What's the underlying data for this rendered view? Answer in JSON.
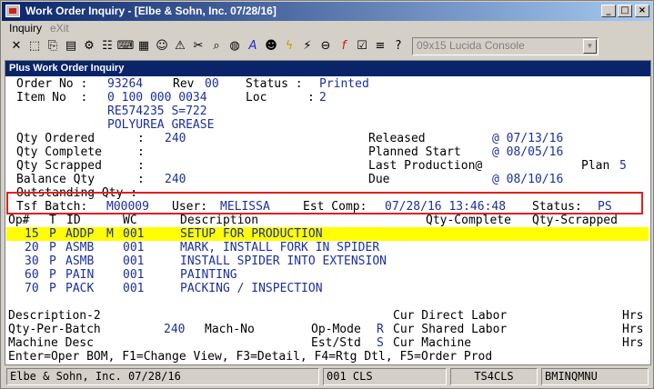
{
  "window": {
    "title": "Work Order Inquiry - [Elbe & Sohn, Inc. 07/28/16]"
  },
  "menu": {
    "items": [
      "Inquiry",
      "eXit"
    ]
  },
  "toolbar": {
    "font_combo": "09x15 Lucida Console"
  },
  "screen": {
    "title": "Plus Work Order Inquiry",
    "order_no_label": "Order No :",
    "order_no": "93264",
    "rev_label": "Rev",
    "rev": "00",
    "status_label": "Status :",
    "status": "Printed",
    "item_no_label": "Item No  :",
    "item_no": "0 100 000 0034",
    "loc_label": "Loc",
    "loc_colon": ":",
    "loc": "2",
    "item_line2": "RE574235 S=722",
    "item_line3": "POLYUREA GREASE",
    "qty_ordered_label": "Qty Ordered      :",
    "qty_ordered": "240",
    "qty_complete_label": "Qty Complete     :",
    "qty_scrapped_label": "Qty Scrapped     :",
    "balance_qty_label": "Balance Qty      :",
    "balance_qty": "240",
    "outstanding_label": "Outstanding Qty :",
    "released_label": "Released",
    "released": "@ 07/13/16",
    "planned_start_label": "Planned Start",
    "planned_start": "@ 08/05/16",
    "last_production_label": "Last Production@",
    "plan_label": "Plan",
    "plan": "5",
    "due_label": "Due",
    "due": "@ 08/10/16",
    "tsf_batch_label": "Tsf Batch:",
    "tsf_batch": "M00009",
    "user_label": "User:",
    "user": "MELISSA",
    "est_comp_label": "Est Comp:",
    "est_comp": "07/28/16 13:46:48",
    "tsf_status_label": "Status:",
    "tsf_status": "PS",
    "columns": {
      "op": "Op#",
      "t": "T",
      "id": "ID",
      "wc": "WC",
      "desc": "Description",
      "qty_complete": "Qty-Complete",
      "qty_scrapped": "Qty-Scrapped"
    },
    "operations": [
      {
        "op": "15",
        "t": "P",
        "id": "ADDP",
        "m": "M",
        "wc": "001",
        "desc": "SETUP FOR PRODUCTION"
      },
      {
        "op": "20",
        "t": "P",
        "id": "ASMB",
        "m": "",
        "wc": "001",
        "desc": "MARK, INSTALL FORK IN SPIDER"
      },
      {
        "op": "30",
        "t": "P",
        "id": "ASMB",
        "m": "",
        "wc": "001",
        "desc": "INSTALL SPIDER INTO EXTENSION"
      },
      {
        "op": "60",
        "t": "P",
        "id": "PAIN",
        "m": "",
        "wc": "001",
        "desc": "PAINTING"
      },
      {
        "op": "70",
        "t": "P",
        "id": "PACK",
        "m": "",
        "wc": "001",
        "desc": "PACKING / INSPECTION"
      }
    ],
    "description2_label": "Description-2",
    "qty_per_batch_label": "Qty-Per-Batch",
    "qty_per_batch": "240",
    "mach_no_label": "Mach-No",
    "machine_desc_label": "Machine Desc",
    "op_mode_label": "Op-Mode",
    "op_mode": "R",
    "est_std_label": "Est/Std",
    "est_std": "S",
    "cur_direct_labor_label": "Cur Direct Labor",
    "cur_shared_labor_label": "Cur Shared Labor",
    "cur_machine_label": "Cur Machine",
    "hrs": "Hrs",
    "help_line": "Enter=Oper BOM, F1=Change View, F3=Detail, F4=Rtg Dtl, F5=Order Prod"
  },
  "statusbar": {
    "company": "Elbe & Sohn, Inc. 07/28/16",
    "cls": "001 CLS",
    "session": "TS4CLS",
    "program": "BMINQMNU"
  },
  "colors": {
    "highlight": "#ffff00",
    "data_blue": "#1c2f9e",
    "title_navy": "#0a246a",
    "callout_red": "#e02020"
  }
}
